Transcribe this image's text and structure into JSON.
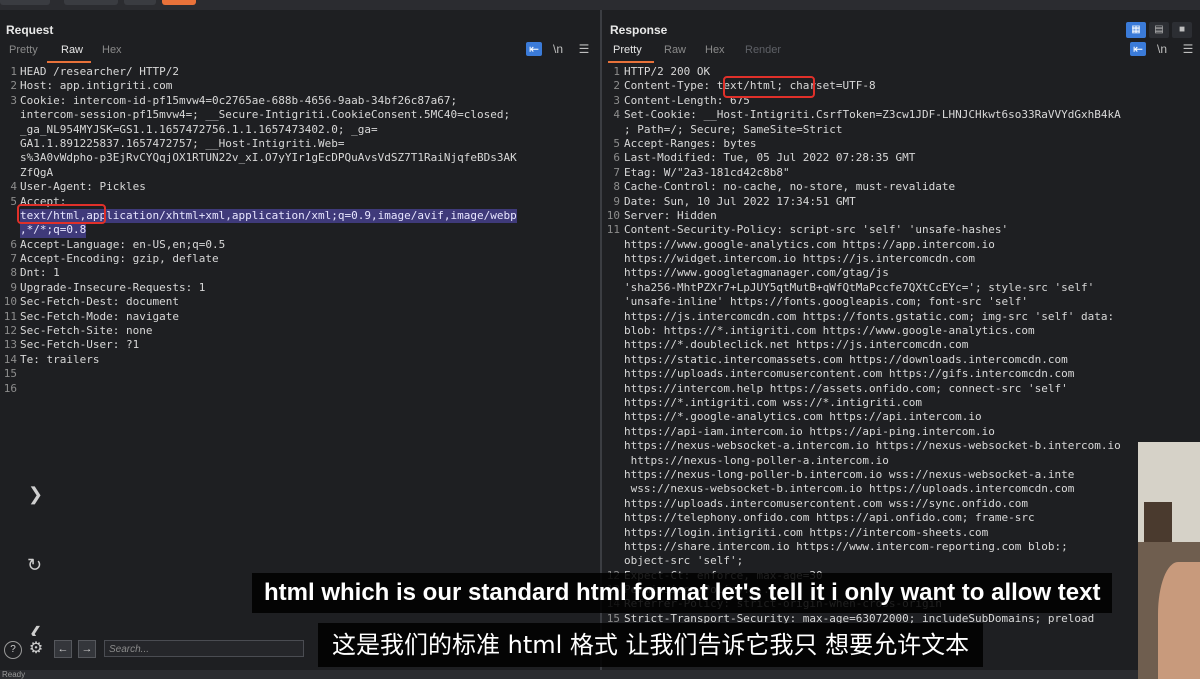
{
  "request": {
    "title": "Request",
    "tabs": [
      "Pretty",
      "Raw",
      "Hex"
    ],
    "active_tab": "Raw",
    "lines": [
      {
        "n": "1",
        "t": "HEAD /researcher/ HTTP/2"
      },
      {
        "n": "2",
        "t": "Host: app.intigriti.com"
      },
      {
        "n": "3",
        "t": "Cookie: intercom-id-pf15mvw4=0c2765ae-688b-4656-9aab-34bf26c87a67;"
      },
      {
        "n": "",
        "t": "intercom-session-pf15mvw4=; __Secure-Intigriti.CookieConsent.5MC40=closed;"
      },
      {
        "n": "",
        "t": "_ga_NL954MYJSK=GS1.1.1657472756.1.1.1657473402.0; _ga="
      },
      {
        "n": "",
        "t": "GA1.1.891225837.1657472757; __Host-Intigriti.Web="
      },
      {
        "n": "",
        "t": "s%3A0vWdpho-p3EjRvCYQqjOX1RTUN22v_xI.O7yYIr1gEcDPQuAvsVdSZ7T1RaiNjqfeBDs3AK"
      },
      {
        "n": "",
        "t": "ZfQgA"
      },
      {
        "n": "4",
        "t": "User-Agent: Pickles"
      },
      {
        "n": "5",
        "t": "Accept:"
      },
      {
        "n": "",
        "t": "text/html,application/xhtml+xml,application/xml;q=0.9,image/avif,image/webp",
        "sel": true
      },
      {
        "n": "",
        "t": ",*/*;q=0.8",
        "sel": true
      },
      {
        "n": "6",
        "t": "Accept-Language: en-US,en;q=0.5"
      },
      {
        "n": "7",
        "t": "Accept-Encoding: gzip, deflate"
      },
      {
        "n": "8",
        "t": "Dnt: 1"
      },
      {
        "n": "9",
        "t": "Upgrade-Insecure-Requests: 1"
      },
      {
        "n": "10",
        "t": "Sec-Fetch-Dest: document"
      },
      {
        "n": "11",
        "t": "Sec-Fetch-Mode: navigate"
      },
      {
        "n": "12",
        "t": "Sec-Fetch-Site: none"
      },
      {
        "n": "13",
        "t": "Sec-Fetch-User: ?1"
      },
      {
        "n": "14",
        "t": "Te: trailers"
      },
      {
        "n": "15",
        "t": ""
      },
      {
        "n": "16",
        "t": ""
      }
    ]
  },
  "response": {
    "title": "Response",
    "tabs": [
      "Pretty",
      "Raw",
      "Hex",
      "Render"
    ],
    "active_tab": "Pretty",
    "lines": [
      {
        "n": "1",
        "t": "HTTP/2 200 OK"
      },
      {
        "n": "2",
        "t": "Content-Type: text/html; charset=UTF-8"
      },
      {
        "n": "3",
        "t": "Content-Length: 675"
      },
      {
        "n": "4",
        "t": "Set-Cookie: __Host-Intigriti.CsrfToken=Z3cw1JDF-LHNJCHkwt6so33RaVVYdGxhB4kA"
      },
      {
        "n": "",
        "t": "; Path=/; Secure; SameSite=Strict"
      },
      {
        "n": "5",
        "t": "Accept-Ranges: bytes"
      },
      {
        "n": "6",
        "t": "Last-Modified: Tue, 05 Jul 2022 07:28:35 GMT"
      },
      {
        "n": "7",
        "t": "Etag: W/\"2a3-181cd42c8b8\""
      },
      {
        "n": "8",
        "t": "Cache-Control: no-cache, no-store, must-revalidate"
      },
      {
        "n": "9",
        "t": "Date: Sun, 10 Jul 2022 17:34:51 GMT"
      },
      {
        "n": "10",
        "t": "Server: Hidden"
      },
      {
        "n": "11",
        "t": "Content-Security-Policy: script-src 'self' 'unsafe-hashes'"
      },
      {
        "n": "",
        "t": "https://www.google-analytics.com https://app.intercom.io"
      },
      {
        "n": "",
        "t": "https://widget.intercom.io https://js.intercomcdn.com"
      },
      {
        "n": "",
        "t": "https://www.googletagmanager.com/gtag/js"
      },
      {
        "n": "",
        "t": "'sha256-MhtPZXr7+LpJUY5qtMutB+qWfQtMaPccfe7QXtCcEYc='; style-src 'self'"
      },
      {
        "n": "",
        "t": "'unsafe-inline' https://fonts.googleapis.com; font-src 'self'"
      },
      {
        "n": "",
        "t": "https://js.intercomcdn.com https://fonts.gstatic.com; img-src 'self' data:"
      },
      {
        "n": "",
        "t": "blob: https://*.intigriti.com https://www.google-analytics.com"
      },
      {
        "n": "",
        "t": "https://*.doubleclick.net https://js.intercomcdn.com"
      },
      {
        "n": "",
        "t": "https://static.intercomassets.com https://downloads.intercomcdn.com"
      },
      {
        "n": "",
        "t": "https://uploads.intercomusercontent.com https://gifs.intercomcdn.com"
      },
      {
        "n": "",
        "t": "https://intercom.help https://assets.onfido.com; connect-src 'self'"
      },
      {
        "n": "",
        "t": "https://*.intigriti.com wss://*.intigriti.com"
      },
      {
        "n": "",
        "t": "https://*.google-analytics.com https://api.intercom.io"
      },
      {
        "n": "",
        "t": "https://api-iam.intercom.io https://api-ping.intercom.io"
      },
      {
        "n": "",
        "t": "https://nexus-websocket-a.intercom.io https://nexus-websocket-b.intercom.io"
      },
      {
        "n": "",
        "t": " https://nexus-long-poller-a.intercom.io"
      },
      {
        "n": "",
        "t": "https://nexus-long-poller-b.intercom.io wss://nexus-websocket-a.inte"
      },
      {
        "n": "",
        "t": " wss://nexus-websocket-b.intercom.io https://uploads.intercomcdn.com"
      },
      {
        "n": "",
        "t": "https://uploads.intercomusercontent.com wss://sync.onfido.com"
      },
      {
        "n": "",
        "t": "https://telephony.onfido.com https://api.onfido.com; frame-src"
      },
      {
        "n": "",
        "t": "https://login.intigriti.com https://intercom-sheets.com"
      },
      {
        "n": "",
        "t": "https://share.intercom.io https://www.intercom-reporting.com blob:;"
      },
      {
        "n": "",
        "t": "object-src 'self';"
      },
      {
        "n": "12",
        "t": "Expect-Ct: enforce, max-age=30"
      },
      {
        "n": "13",
        "t": "Permissions-Policy: ..."
      },
      {
        "n": "14",
        "t": "Referrer-Policy: strict-origin-when-cross-origin"
      },
      {
        "n": "15",
        "t": "Strict-Transport-Security: max-age=63072000; includeSubDomains; preload"
      }
    ]
  },
  "toolbar_icons": [
    "wrap-icon",
    "newline-icon",
    "menu-icon"
  ],
  "bottom_bar": {
    "search_placeholder": "Search..."
  },
  "status_text": "Ready",
  "subtitles": {
    "en": "html which is our standard html format let's tell it i only want to allow text",
    "zh": "这是我们的标准 html 格式 让我们告诉它我只 想要允许文本"
  }
}
